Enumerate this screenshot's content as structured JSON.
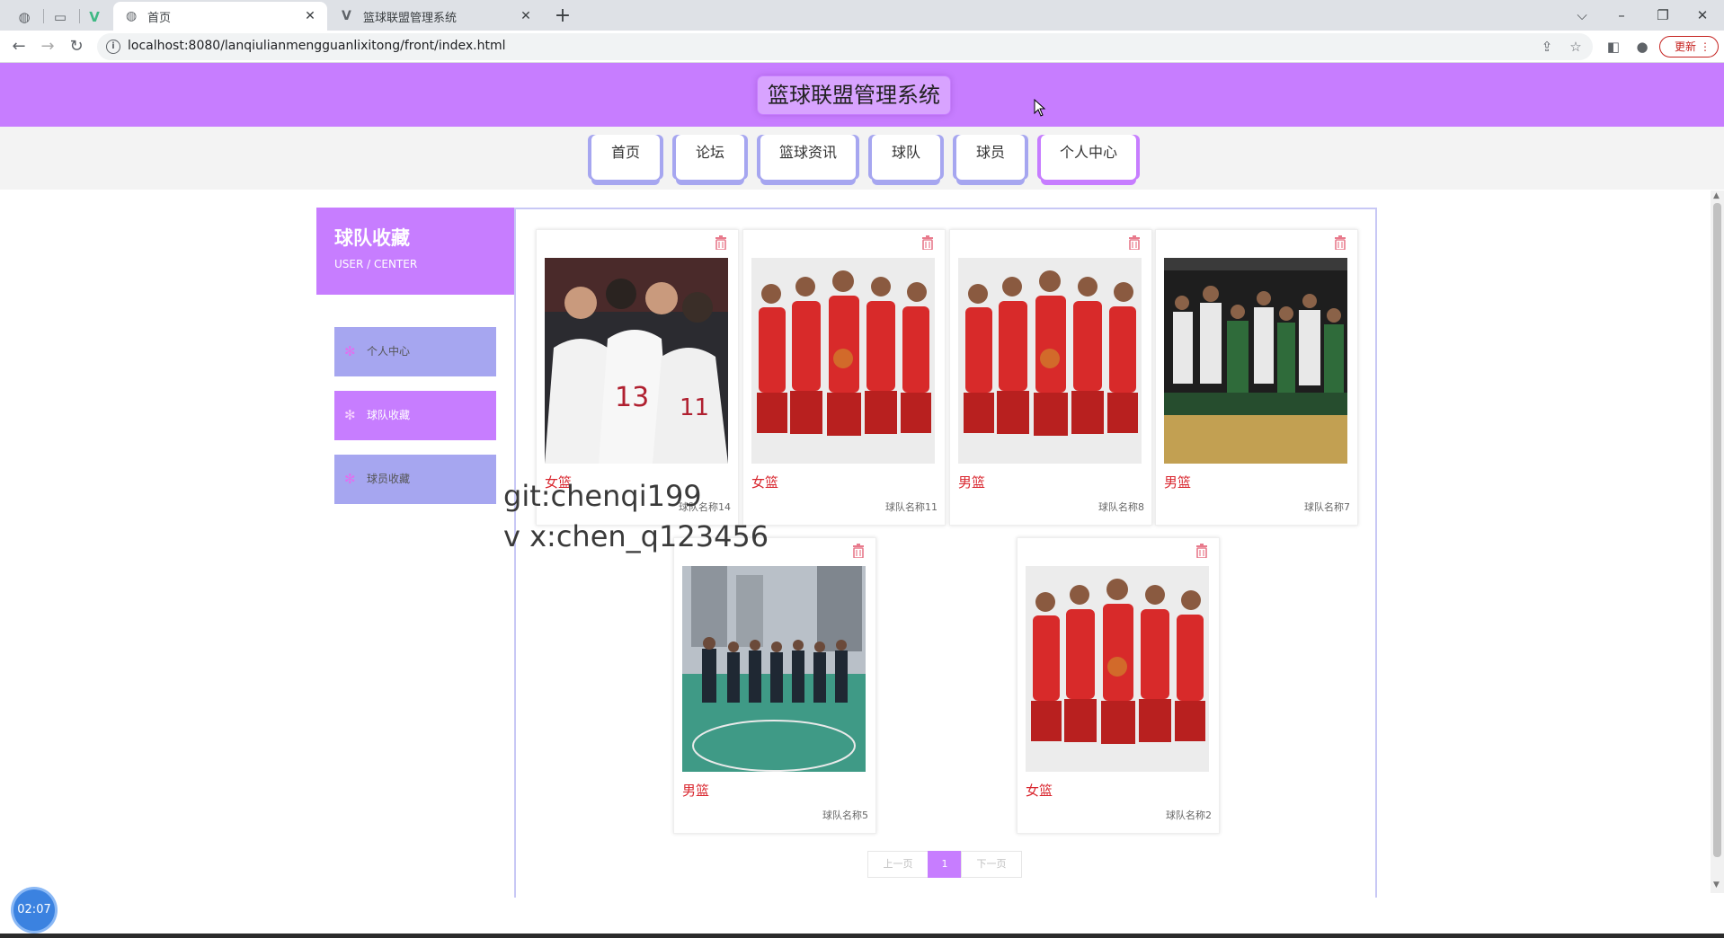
{
  "browser": {
    "tabs": [
      {
        "title": "首页",
        "active": true
      },
      {
        "title": "篮球联盟管理系统",
        "active": false
      }
    ],
    "url": "localhost:8080/lanqiulianmengguanlixitong/front/index.html",
    "update_label": "更新"
  },
  "site": {
    "title": "篮球联盟管理系统",
    "nav": [
      "首页",
      "论坛",
      "篮球资讯",
      "球队",
      "球员",
      "个人中心"
    ],
    "active_nav": "个人中心"
  },
  "sidebar": {
    "title": "球队收藏",
    "subtitle": "USER / CENTER",
    "items": [
      {
        "label": "个人中心",
        "active": false
      },
      {
        "label": "球队收藏",
        "active": true
      },
      {
        "label": "球员收藏",
        "active": false
      }
    ]
  },
  "cards": [
    {
      "type": "女篮",
      "team": "球队名称14",
      "photo": "huddle"
    },
    {
      "type": "女篮",
      "team": "球队名称11",
      "photo": "red-team"
    },
    {
      "type": "男篮",
      "team": "球队名称8",
      "photo": "red-team"
    },
    {
      "type": "男篮",
      "team": "球队名称7",
      "photo": "celebration"
    },
    {
      "type": "男篮",
      "team": "球队名称5",
      "photo": "court-group"
    },
    {
      "type": "女篮",
      "team": "球队名称2",
      "photo": "red-team"
    }
  ],
  "pagination": {
    "prev": "上一页",
    "current": "1",
    "next": "下一页"
  },
  "watermark": [
    "git:chenqi199",
    "v x:chen_q123456"
  ],
  "timer": "02:07",
  "colors": {
    "accent": "#c77dff",
    "menu": "#a6a6f0",
    "type_text": "#d9262e"
  }
}
